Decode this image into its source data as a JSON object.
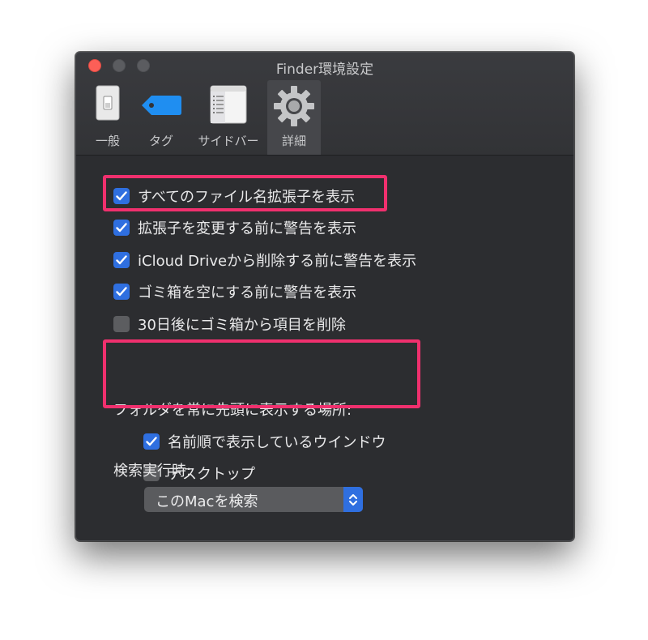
{
  "window": {
    "title": "Finder環境設定"
  },
  "tabs": [
    {
      "label": "一般",
      "icon": "switch-icon"
    },
    {
      "label": "タグ",
      "icon": "tag-icon"
    },
    {
      "label": "サイドバー",
      "icon": "sidebar-icon"
    },
    {
      "label": "詳細",
      "icon": "gear-icon",
      "selected": true
    }
  ],
  "options": [
    {
      "label": "すべてのファイル名拡張子を表示",
      "checked": true
    },
    {
      "label": "拡張子を変更する前に警告を表示",
      "checked": true
    },
    {
      "label": "iCloud Driveから削除する前に警告を表示",
      "checked": true
    },
    {
      "label": "ゴミ箱を空にする前に警告を表示",
      "checked": true
    },
    {
      "label": "30日後にゴミ箱から項目を削除",
      "checked": false
    }
  ],
  "folders_on_top": {
    "heading": "フォルダを常に先頭に表示する場所:",
    "items": [
      {
        "label": "名前順で表示しているウインドウ",
        "checked": true
      },
      {
        "label": "デスクトップ",
        "checked": false
      }
    ]
  },
  "search": {
    "heading": "検索実行時:",
    "selected": "このMacを検索"
  },
  "colors": {
    "accent": "#2f6fe0",
    "highlight": "#f0306e",
    "close": "#fc5f57"
  }
}
